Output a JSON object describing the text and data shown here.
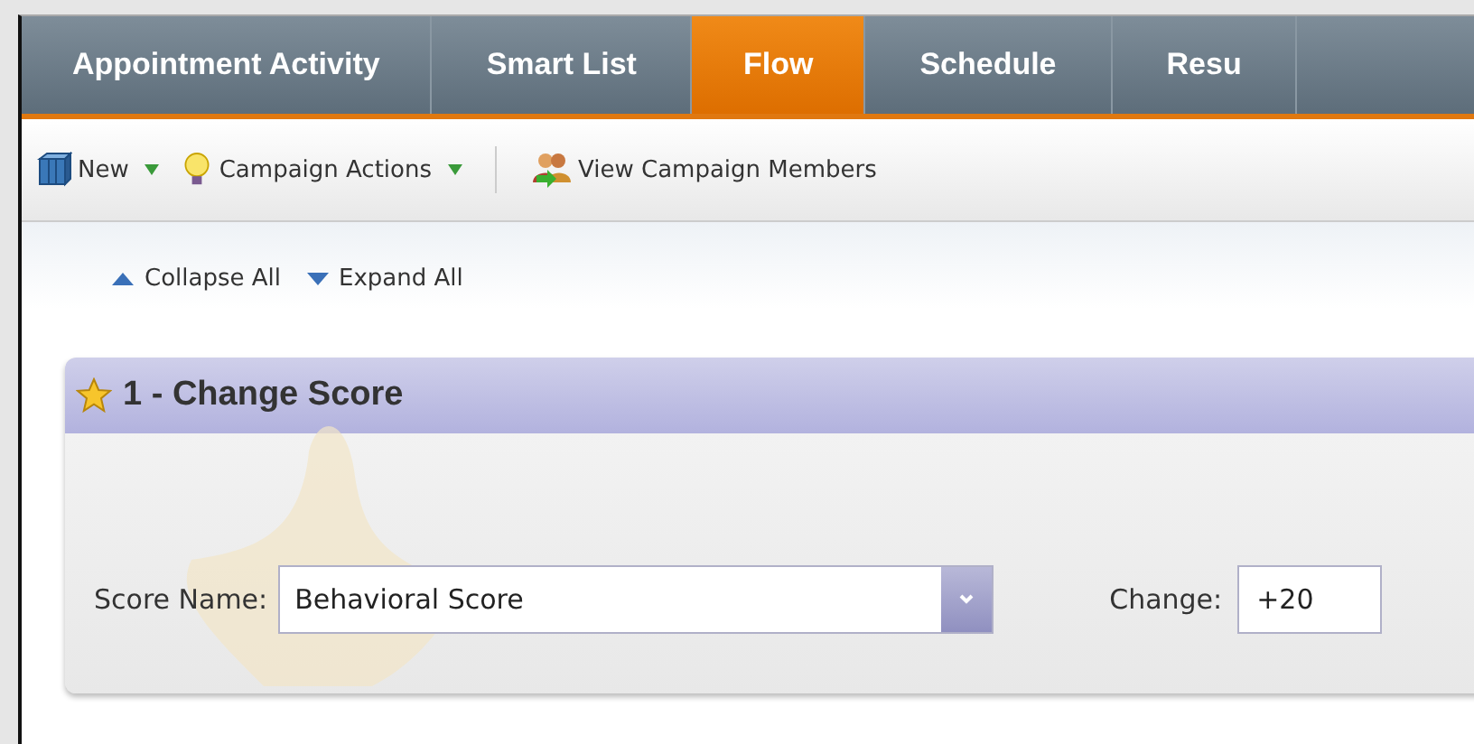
{
  "tabs": [
    {
      "label": "Appointment Activity",
      "selected": false
    },
    {
      "label": "Smart List",
      "selected": false
    },
    {
      "label": "Flow",
      "selected": true
    },
    {
      "label": "Schedule",
      "selected": false
    },
    {
      "label": "Resu",
      "selected": false
    }
  ],
  "toolbar": [
    {
      "kind": "new",
      "label": "New",
      "dropdown": true
    },
    {
      "kind": "actions",
      "label": "Campaign Actions",
      "dropdown": true
    },
    {
      "kind": "members",
      "label": "View Campaign Members",
      "dropdown": false
    }
  ],
  "outline_controls": [
    {
      "kind": "collapse",
      "label": "Collapse All"
    },
    {
      "kind": "expand",
      "label": "Expand All"
    }
  ],
  "flow_step": {
    "title": "1 - Change Score",
    "score_name_label": "Score Name:",
    "score_name_value": "Behavioral Score",
    "change_label": "Change:",
    "change_value": "+20"
  }
}
